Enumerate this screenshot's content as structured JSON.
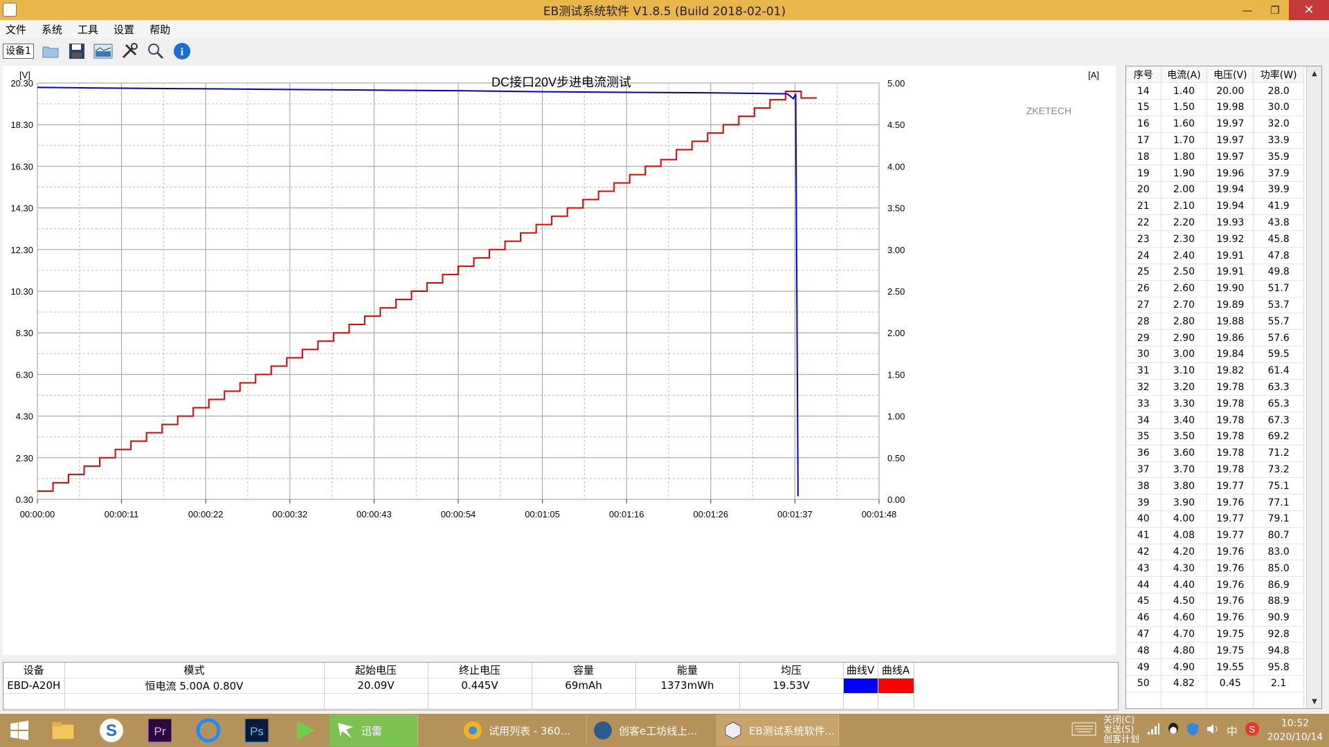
{
  "window": {
    "title": "EB测试系统软件 V1.8.5 (Build 2018-02-01)",
    "minimize": "—",
    "maximize": "❐",
    "close": "✕"
  },
  "menu": [
    "文件",
    "系统",
    "工具",
    "设置",
    "帮助"
  ],
  "toolbar": {
    "device_tab": "设备1",
    "icons": [
      "open-folder-icon",
      "save-icon",
      "image-icon",
      "tools-icon",
      "search-icon",
      "info-icon"
    ]
  },
  "chart_data": {
    "type": "line",
    "title": "DC接口20V步进电流测试",
    "watermark": "ZKETECH",
    "left_axis_unit": "[V]",
    "right_axis_unit": "[A]",
    "left_ticks": [
      "20.30",
      "18.30",
      "16.30",
      "14.30",
      "12.30",
      "10.30",
      "8.30",
      "6.30",
      "4.30",
      "2.30",
      "0.30"
    ],
    "right_ticks": [
      "5.00",
      "4.50",
      "4.00",
      "3.50",
      "3.00",
      "2.50",
      "2.00",
      "1.50",
      "1.00",
      "0.50",
      "0.00"
    ],
    "x_ticks": [
      "00:00:00",
      "00:00:11",
      "00:00:22",
      "00:00:32",
      "00:00:43",
      "00:00:54",
      "00:01:05",
      "00:01:16",
      "00:01:26",
      "00:01:37",
      "00:01:48"
    ],
    "ylim_left": [
      0.3,
      20.3
    ],
    "ylim_right": [
      0.0,
      5.0
    ],
    "x_range_seconds": [
      0,
      108
    ],
    "series": [
      {
        "name": "V",
        "color": "#0000cc",
        "points": [
          [
            0,
            20.09
          ],
          [
            5,
            20.07
          ],
          [
            11,
            20.05
          ],
          [
            22,
            20.02
          ],
          [
            32,
            19.99
          ],
          [
            43,
            19.96
          ],
          [
            54,
            19.93
          ],
          [
            65,
            19.88
          ],
          [
            76,
            19.85
          ],
          [
            86,
            19.83
          ],
          [
            96.2,
            19.78
          ],
          [
            97,
            19.55
          ],
          [
            97.3,
            19.78
          ],
          [
            97.6,
            0.45
          ]
        ]
      },
      {
        "name": "A",
        "color": "#dd0000",
        "step_values": [
          0.1,
          0.2,
          0.3,
          0.4,
          0.5,
          0.6,
          0.7,
          0.8,
          0.9,
          1.0,
          1.1,
          1.2,
          1.3,
          1.4,
          1.5,
          1.6,
          1.7,
          1.8,
          1.9,
          2.0,
          2.1,
          2.2,
          2.3,
          2.4,
          2.5,
          2.6,
          2.7,
          2.8,
          2.9,
          3.0,
          3.1,
          3.2,
          3.3,
          3.4,
          3.5,
          3.6,
          3.7,
          3.8,
          3.9,
          4.0,
          4.08,
          4.2,
          4.3,
          4.4,
          4.5,
          4.6,
          4.7,
          4.8,
          4.9,
          4.82
        ],
        "step_seconds": 2
      }
    ]
  },
  "table": {
    "headers": [
      "序号",
      "电流(A)",
      "电压(V)",
      "功率(W)"
    ],
    "rows": [
      [
        "14",
        "1.40",
        "20.00",
        "28.0"
      ],
      [
        "15",
        "1.50",
        "19.98",
        "30.0"
      ],
      [
        "16",
        "1.60",
        "19.97",
        "32.0"
      ],
      [
        "17",
        "1.70",
        "19.97",
        "33.9"
      ],
      [
        "18",
        "1.80",
        "19.97",
        "35.9"
      ],
      [
        "19",
        "1.90",
        "19.96",
        "37.9"
      ],
      [
        "20",
        "2.00",
        "19.94",
        "39.9"
      ],
      [
        "21",
        "2.10",
        "19.94",
        "41.9"
      ],
      [
        "22",
        "2.20",
        "19.93",
        "43.8"
      ],
      [
        "23",
        "2.30",
        "19.92",
        "45.8"
      ],
      [
        "24",
        "2.40",
        "19.91",
        "47.8"
      ],
      [
        "25",
        "2.50",
        "19.91",
        "49.8"
      ],
      [
        "26",
        "2.60",
        "19.90",
        "51.7"
      ],
      [
        "27",
        "2.70",
        "19.89",
        "53.7"
      ],
      [
        "28",
        "2.80",
        "19.88",
        "55.7"
      ],
      [
        "29",
        "2.90",
        "19.86",
        "57.6"
      ],
      [
        "30",
        "3.00",
        "19.84",
        "59.5"
      ],
      [
        "31",
        "3.10",
        "19.82",
        "61.4"
      ],
      [
        "32",
        "3.20",
        "19.78",
        "63.3"
      ],
      [
        "33",
        "3.30",
        "19.78",
        "65.3"
      ],
      [
        "34",
        "3.40",
        "19.78",
        "67.3"
      ],
      [
        "35",
        "3.50",
        "19.78",
        "69.2"
      ],
      [
        "36",
        "3.60",
        "19.78",
        "71.2"
      ],
      [
        "37",
        "3.70",
        "19.78",
        "73.2"
      ],
      [
        "38",
        "3.80",
        "19.77",
        "75.1"
      ],
      [
        "39",
        "3.90",
        "19.76",
        "77.1"
      ],
      [
        "40",
        "4.00",
        "19.77",
        "79.1"
      ],
      [
        "41",
        "4.08",
        "19.77",
        "80.7"
      ],
      [
        "42",
        "4.20",
        "19.76",
        "83.0"
      ],
      [
        "43",
        "4.30",
        "19.76",
        "85.0"
      ],
      [
        "44",
        "4.40",
        "19.76",
        "86.9"
      ],
      [
        "45",
        "4.50",
        "19.76",
        "88.9"
      ],
      [
        "46",
        "4.60",
        "19.76",
        "90.9"
      ],
      [
        "47",
        "4.70",
        "19.75",
        "92.8"
      ],
      [
        "48",
        "4.80",
        "19.75",
        "94.8"
      ],
      [
        "49",
        "4.90",
        "19.55",
        "95.8"
      ],
      [
        "50",
        "4.82",
        "0.45",
        "2.1"
      ]
    ]
  },
  "summary": {
    "headers": [
      "设备",
      "模式",
      "起始电压",
      "终止电压",
      "容量",
      "能量",
      "均压",
      "曲线V",
      "曲线A"
    ],
    "row": {
      "device": "EBD-A20H",
      "mode": "恒电流  5.00A  0.80V",
      "start_v": "20.09V",
      "end_v": "0.445V",
      "capacity": "69mAh",
      "energy": "1373mWh",
      "avg_v": "19.53V"
    },
    "curve_v_color": "#0000ff",
    "curve_a_color": "#ff0000"
  },
  "taskbar": {
    "pinned": [
      "windows-start-icon",
      "file-explorer-icon",
      "sogou-icon",
      "premiere-icon",
      "browser-icon",
      "photoshop-icon",
      "player-icon"
    ],
    "tasks": [
      {
        "label": "迅雷",
        "icon": "xunlei-icon"
      },
      {
        "label": "试用列表 - 360...",
        "icon": "360-browser-icon"
      },
      {
        "label": "创客e工坊线上...",
        "icon": "maker-icon"
      },
      {
        "label": "EB测试系统软件...",
        "icon": "eb-software-icon"
      }
    ],
    "tray_text_top": "关闭(C)",
    "tray_text_mid": "发送(S)",
    "tray_text_bottom": "创客计划",
    "ime": "中",
    "time": "10:52",
    "date": "2020/10/14"
  }
}
